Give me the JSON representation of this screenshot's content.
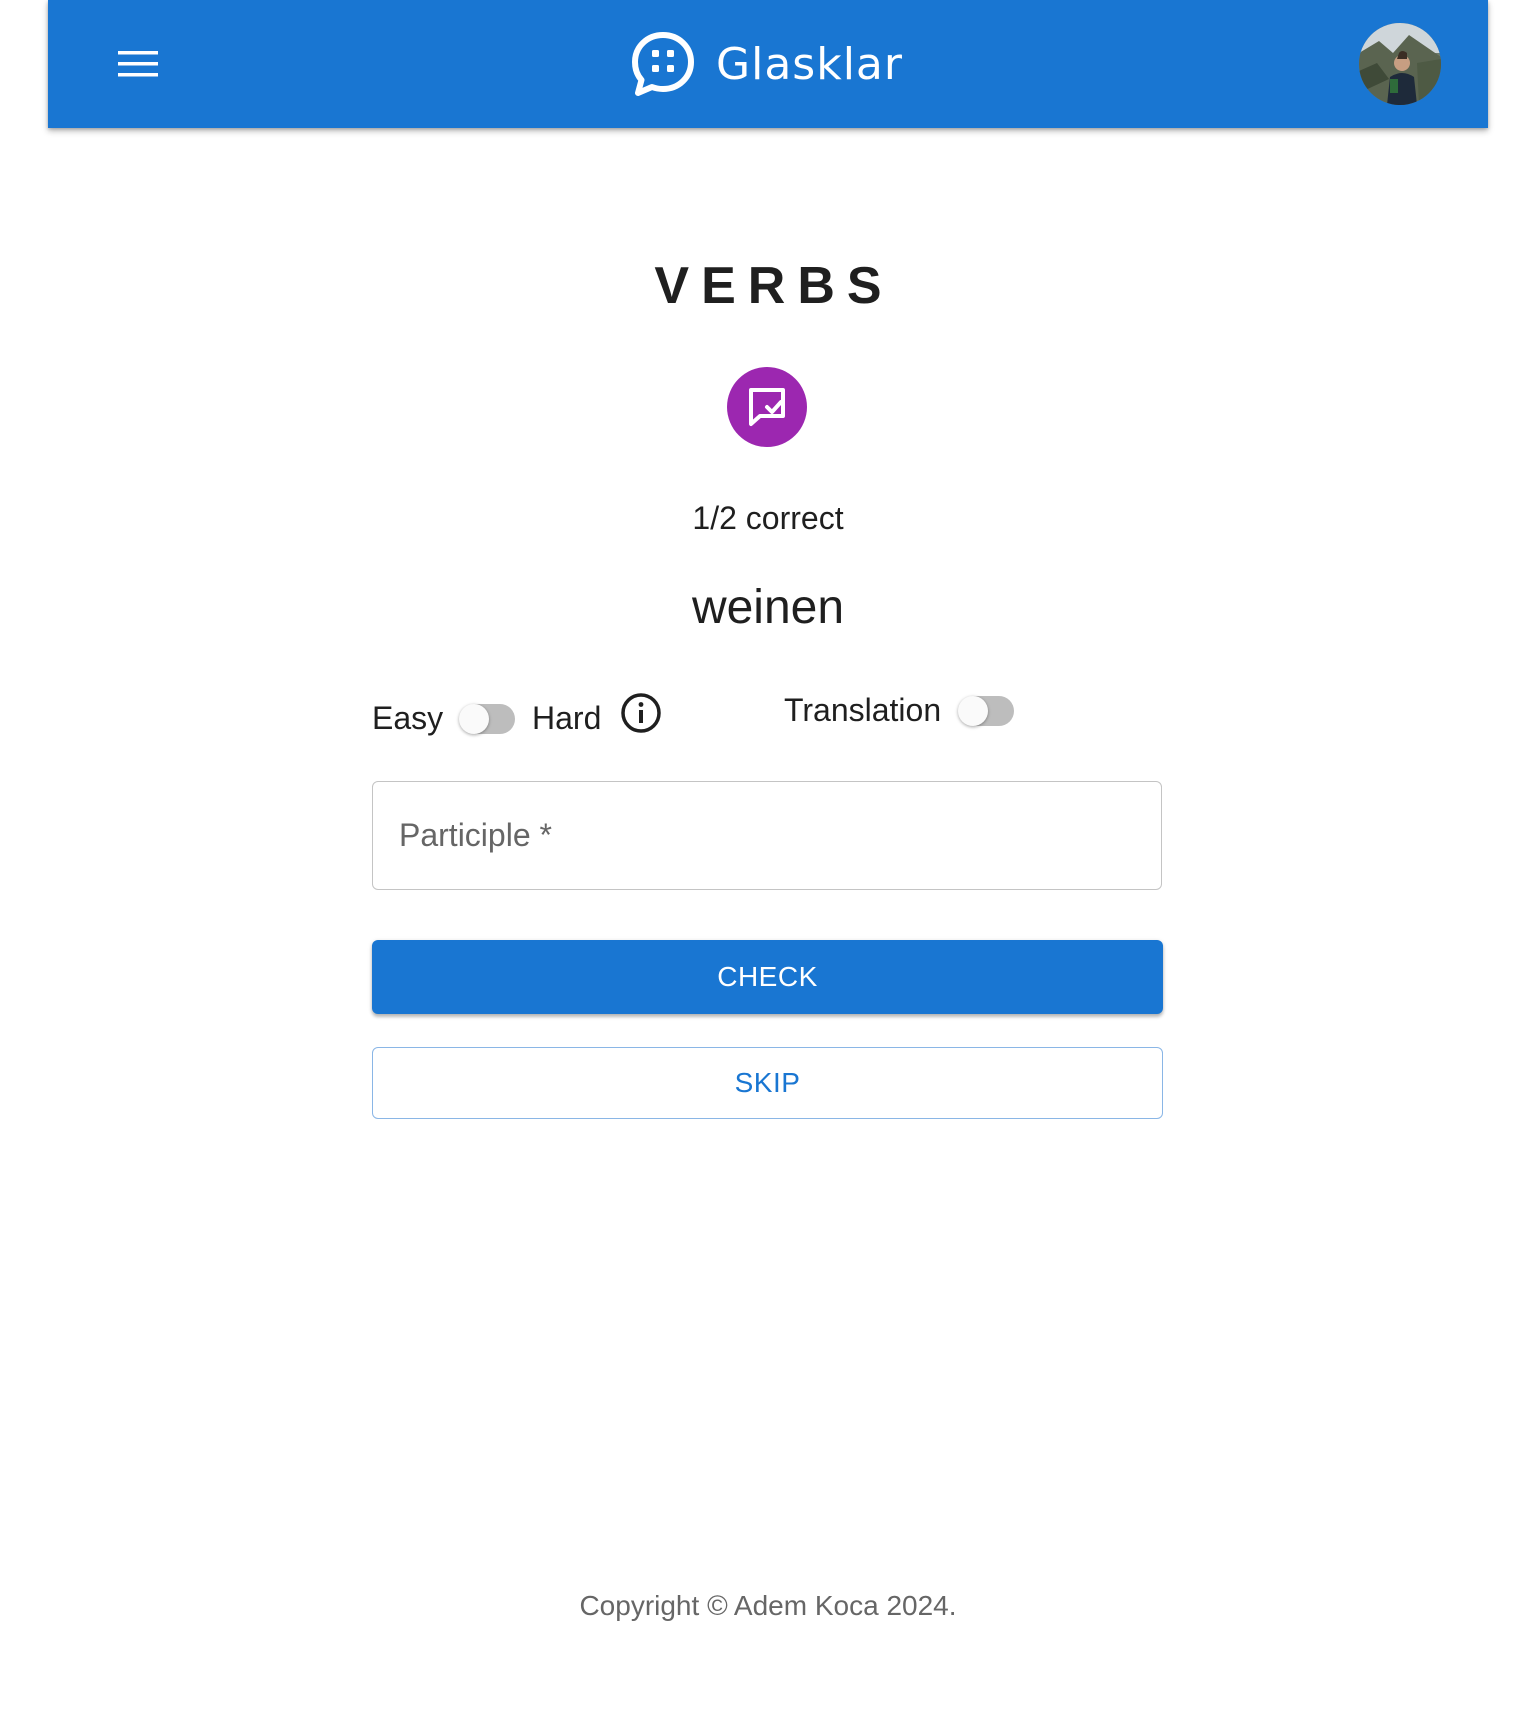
{
  "header": {
    "brand_name": "Glasklar",
    "menu_icon": "menu-icon",
    "logo_icon": "chat-bubble-icon",
    "avatar_alt": "user-avatar",
    "background_color": "#1976d2"
  },
  "main": {
    "title": "VERBS",
    "badge_icon": "quiz-check-icon",
    "badge_color": "#9c27b0",
    "score_text": "1/2 correct",
    "word": "weinen",
    "difficulty": {
      "easy_label": "Easy",
      "hard_label": "Hard",
      "hard_enabled": false,
      "info_icon": "info-icon"
    },
    "translation": {
      "label": "Translation",
      "enabled": false
    },
    "participle_field": {
      "placeholder": "Participle *",
      "value": ""
    },
    "check_label": "CHECK",
    "skip_label": "SKIP"
  },
  "footer": {
    "copyright": "Copyright © Adem Koca 2024."
  }
}
